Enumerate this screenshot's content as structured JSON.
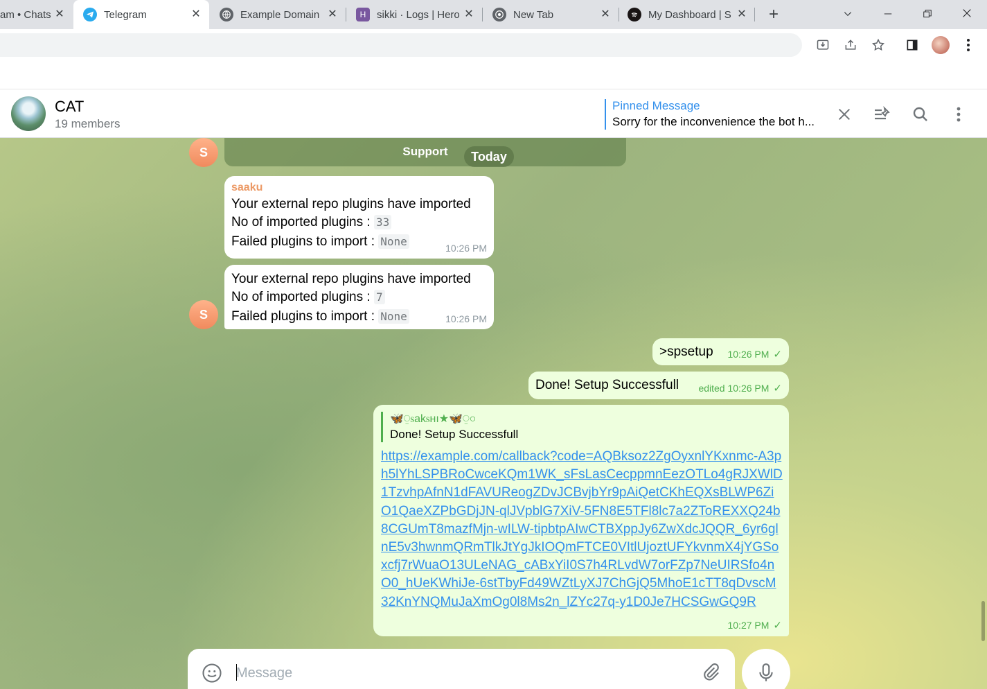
{
  "browser": {
    "tabs": [
      {
        "label": "am • Chats",
        "icon": "telegram-icon"
      },
      {
        "label": "Telegram",
        "icon": "telegram-icon",
        "active": true
      },
      {
        "label": "Example Domain",
        "icon": "globe-icon"
      },
      {
        "label": "sikki · Logs | Hero",
        "icon": "heroku-icon"
      },
      {
        "label": "New Tab",
        "icon": "chrome-icon"
      },
      {
        "label": "My Dashboard | S",
        "icon": "spotify-icon"
      }
    ],
    "colors": {
      "tabstrip": "#dfe1e5",
      "telegram_blue": "#3390ec"
    }
  },
  "chat": {
    "title": "CAT",
    "members": "19 members",
    "pinned_title": "Pinned Message",
    "pinned_text": "Sorry for the inconvenience the bot h..."
  },
  "messages": {
    "support_label": "Support",
    "date_pill": "Today",
    "avatar_letter": "S",
    "m1": {
      "sender": "saaku",
      "line1": "Your external repo plugins have imported",
      "count_label": "No of imported plugins :",
      "count": "33",
      "failed_label": "Failed plugins to import :",
      "failed": "None",
      "time": "10:26 PM"
    },
    "m2": {
      "line1": "Your external repo plugins have imported",
      "count_label": "No of imported plugins :",
      "count": "7",
      "failed_label": "Failed plugins to import :",
      "failed": "None",
      "time": "10:26 PM"
    },
    "m3": {
      "text": ">spsetup",
      "time": "10:26 PM"
    },
    "m4": {
      "text": "Done! Setup Successfull",
      "time": "edited 10:26 PM"
    },
    "m5": {
      "reply_name": "🦋⍜ꮪakꮪнı★🦋⍜○",
      "reply_text": "Done! Setup Successfull",
      "link": "https://example.com/callback?code=AQBksoz2ZgOyxnlYKxnmc-A3ph5lYhLSPBRoCwceKQm1WK_sFsLasCecppmnEezOTLo4gRJXWlD1TzvhpAfnN1dFAVUReogZDvJCBvjbYr9pAiQetCKhEQXsBLWP6ZiO1QaeXZPbGDjJN-qlJVpblG7XiV-5FN8E5TFl8lc7a2ZToREXXQ24b8CGUmT8mazfMjn-wILW-tipbtpAIwCTBXppJy6ZwXdcJQQR_6yr6glnE5v3hwnmQRmTlkJtYgJkIOQmFTCE0VItlUjoztUFYkvnmX4jYGSoxcfj7rWuaO13ULeNAG_cABxYiI0S7h4RLvdW7orFZp7NeUIRSfo4nO0_hUeKWhiJe-6stTbyFd49WZtLyXJ7ChGjQ5MhoE1cTT8qDvscM32KnYNQMuJaXmOg0l8Ms2n_lZYc27q-y1D0Je7HCSGwGQ9R",
      "time": "10:27 PM"
    }
  },
  "composer": {
    "placeholder": "Message"
  }
}
